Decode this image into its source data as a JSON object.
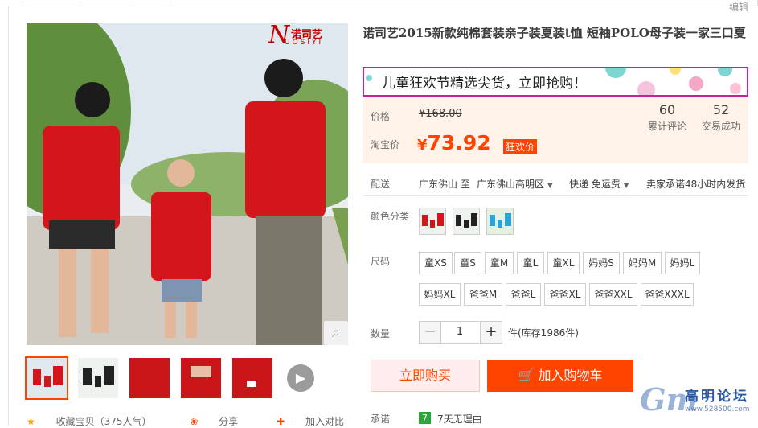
{
  "header": {
    "edit_label": "编辑"
  },
  "gallery": {
    "brand_cn": "诺司艺",
    "brand_en": "UOSIYI",
    "brand_initial": "N",
    "video_icon": "play-icon",
    "zoom_icon": "magnifier-icon"
  },
  "bottom_actions": {
    "favorite": "收藏宝贝（375人气）",
    "share": "分享",
    "compare": "加入对比"
  },
  "product": {
    "title": "诺司艺2015新款纯棉套装亲子装夏装t恤 短袖POLO母子装一家三口夏",
    "promo": "儿童狂欢节精选尖货，立即抢购！",
    "price_label": "价格",
    "original_price": "¥168.00",
    "taobao_price_label": "淘宝价",
    "currency": "¥",
    "current_price": "73.92",
    "promo_tag": "狂欢价",
    "reviews_count": "60",
    "reviews_label": "累计评论",
    "sales_count": "52",
    "sales_label": "交易成功"
  },
  "shipping": {
    "label": "配送",
    "from": "广东佛山",
    "to_word": "至",
    "to": "广东佛山高明区",
    "method": "快递 免运费",
    "promise": "卖家承诺48小时内发货"
  },
  "sku": {
    "color_label": "颜色分类",
    "size_label": "尺码",
    "sizes_row1": [
      "童XS",
      "童S",
      "童M",
      "童L",
      "童XL",
      "妈妈S",
      "妈妈M",
      "妈妈L"
    ],
    "sizes_row2": [
      "妈妈XL",
      "爸爸M",
      "爸爸L",
      "爸爸XL",
      "爸爸XXL",
      "爸爸XXXL"
    ]
  },
  "quantity": {
    "label": "数量",
    "value": "1",
    "minus": "−",
    "plus": "+",
    "stock": "件(库存1986件)"
  },
  "actions": {
    "buy_now": "立即购买",
    "add_to_cart": "加入购物车"
  },
  "promise": {
    "label": "承诺",
    "badge": "7",
    "text": "7天无理由"
  },
  "watermark": {
    "logo_letter": "Gm",
    "name": "高明论坛",
    "url": "www.528500.com"
  },
  "colors": {
    "accent": "#ff4400",
    "promo_border": "#c6238c",
    "price_bg": "#fff2e8"
  }
}
